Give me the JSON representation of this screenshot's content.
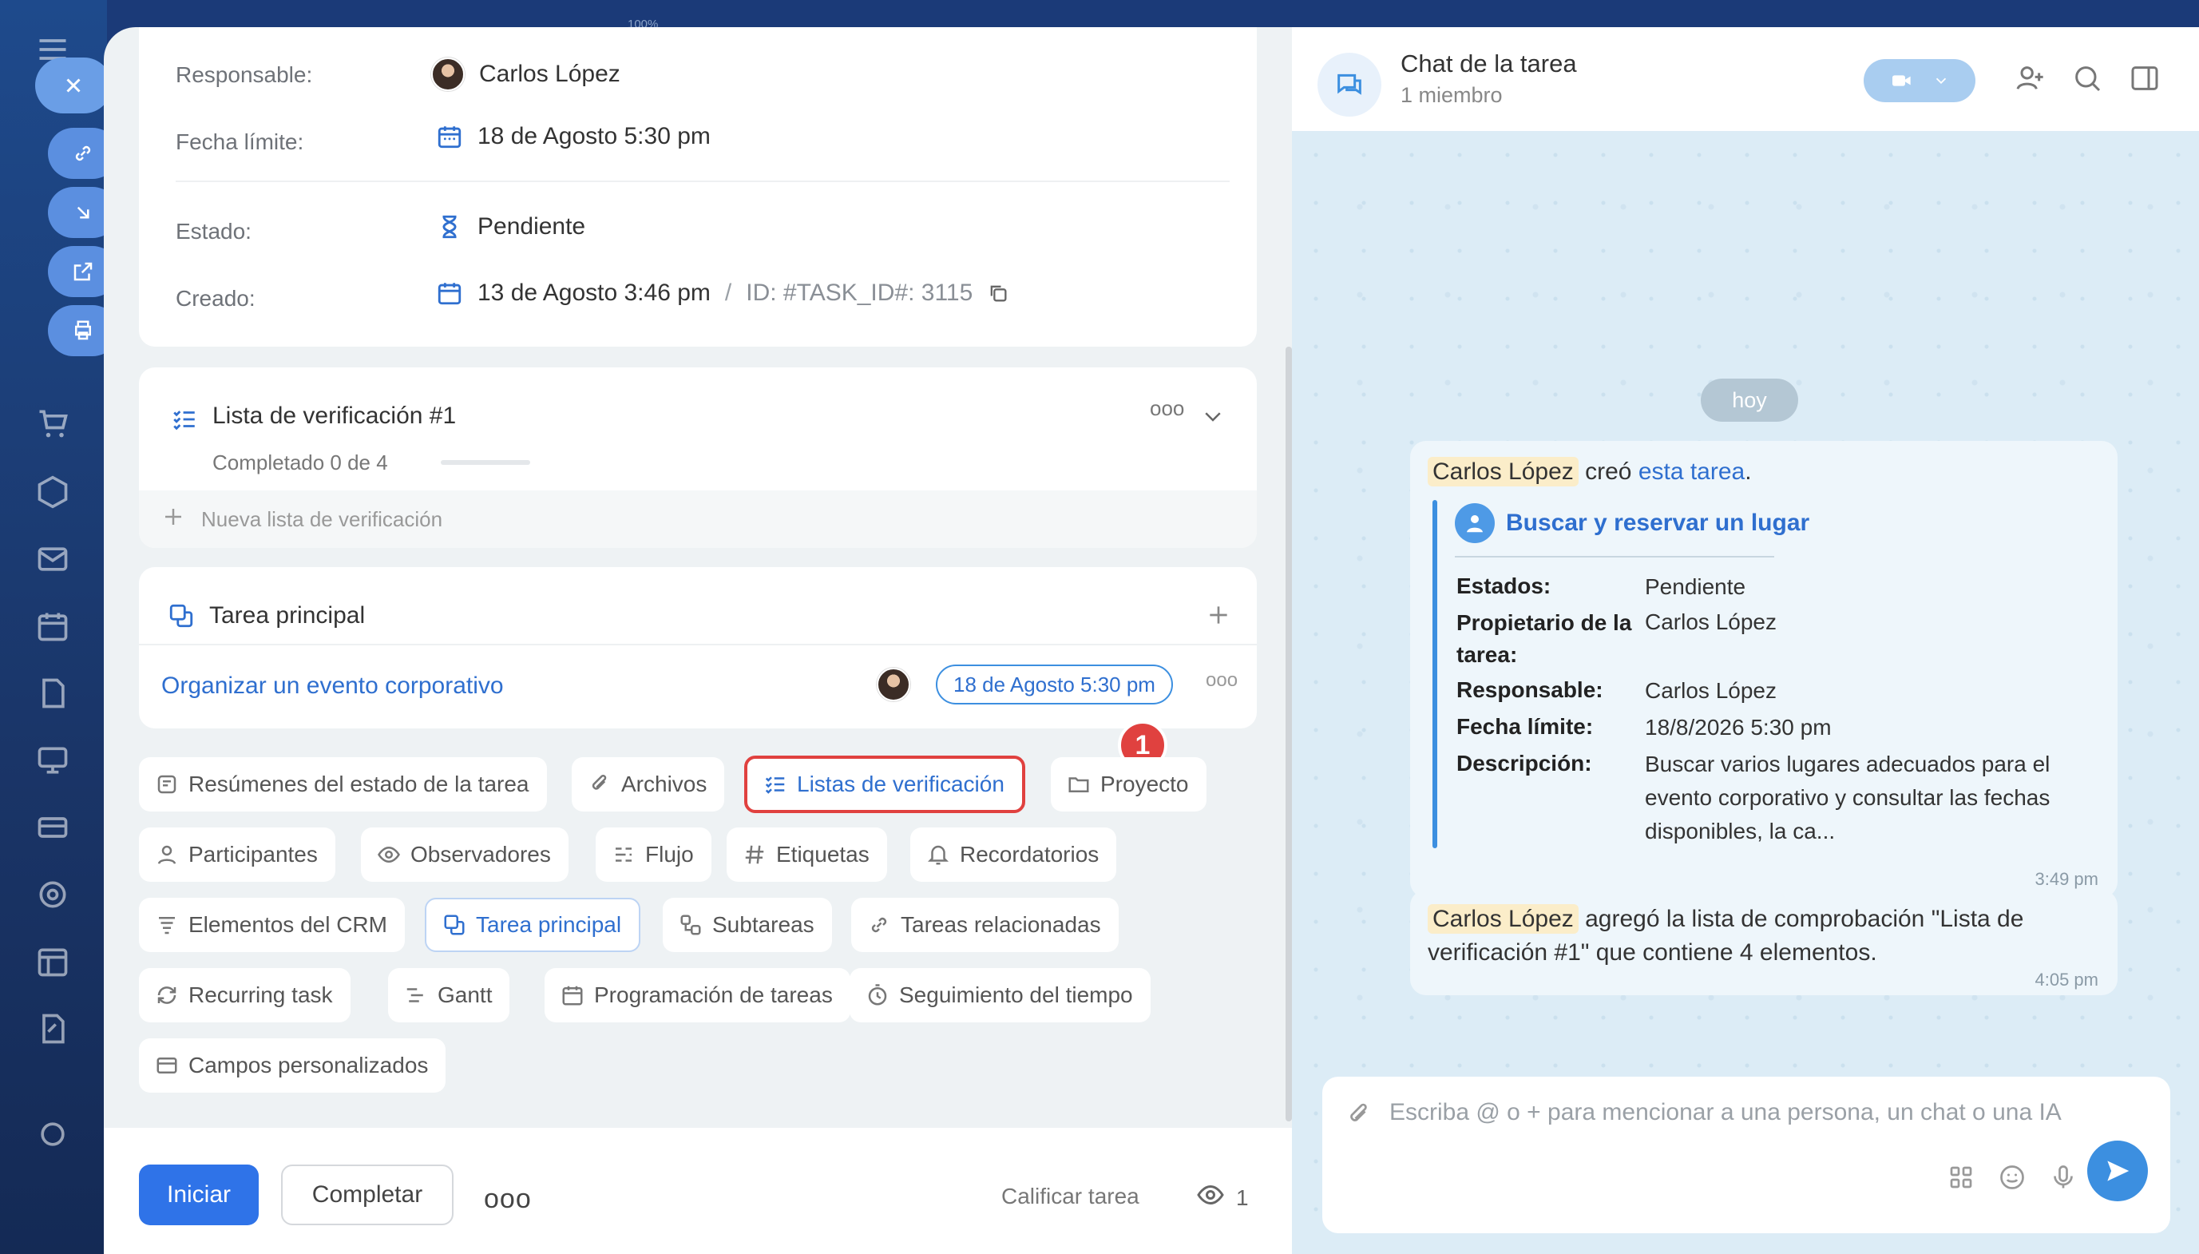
{
  "zoom_label": "100%",
  "task": {
    "fields": [
      {
        "label": "Responsable:",
        "value": "Carlos López"
      },
      {
        "label": "Fecha límite:",
        "value": "18 de Agosto 5:30 pm"
      },
      {
        "label": "Estado:",
        "value": "Pendiente"
      },
      {
        "label": "Creado:",
        "value": "13 de Agosto 3:46 pm",
        "separator": "/",
        "id_text": "ID: #TASK_ID#: 3115"
      }
    ]
  },
  "checklist": {
    "title": "Lista de verificación #1",
    "progress_text": "Completado 0 de 4",
    "progress_done": 0,
    "progress_total": 4,
    "new_list": "Nueva lista de verificación"
  },
  "parent_task": {
    "title": "Tarea principal",
    "link": "Organizar un evento corporativo",
    "deadline": "18 de Agosto 5:30 pm"
  },
  "chips": [
    "Resúmenes del estado de la tarea",
    "Archivos",
    "Listas de verificación",
    "Proyecto",
    "Participantes",
    "Observadores",
    "Flujo",
    "Etiquetas",
    "Recordatorios",
    "Elementos del CRM",
    "Tarea principal",
    "Subtareas",
    "Tareas relacionadas",
    "Recurring task",
    "Gantt",
    "Programación de tareas",
    "Seguimiento del tiempo",
    "Campos personalizados"
  ],
  "callout_number": "1",
  "footer": {
    "start": "Iniciar",
    "complete": "Completar",
    "more": "ooo",
    "rate": "Calificar tarea",
    "views": "1"
  },
  "chat": {
    "title": "Chat de la tarea",
    "subtitle": "1 miembro",
    "today": "hoy",
    "msg1": {
      "author": "Carlos López",
      "verb": "creó",
      "link": "esta tarea",
      "period": ".",
      "card_title": "Buscar y reservar un lugar",
      "fields": [
        {
          "k": "Estados:",
          "v": "Pendiente"
        },
        {
          "k": "Propietario de la tarea:",
          "v": "Carlos López"
        },
        {
          "k": "Responsable:",
          "v": "Carlos López"
        },
        {
          "k": "Fecha límite:",
          "v": "18/8/2026 5:30 pm"
        },
        {
          "k": "Descripción:",
          "v": "Buscar varios lugares adecuados para el evento corporativo y consultar las fechas disponibles, la ca..."
        }
      ],
      "time": "3:49 pm"
    },
    "msg2": {
      "author": "Carlos López",
      "text": "agregó la lista de comprobación \"Lista de verificación #1\" que contiene 4 elementos.",
      "time": "4:05 pm"
    },
    "input_placeholder": "Escriba @ o + para mencionar a una persona, un chat o una IA"
  },
  "colors": {
    "accent": "#2f73e8",
    "highlight": "#e0413f",
    "link": "#2f6fcf"
  }
}
